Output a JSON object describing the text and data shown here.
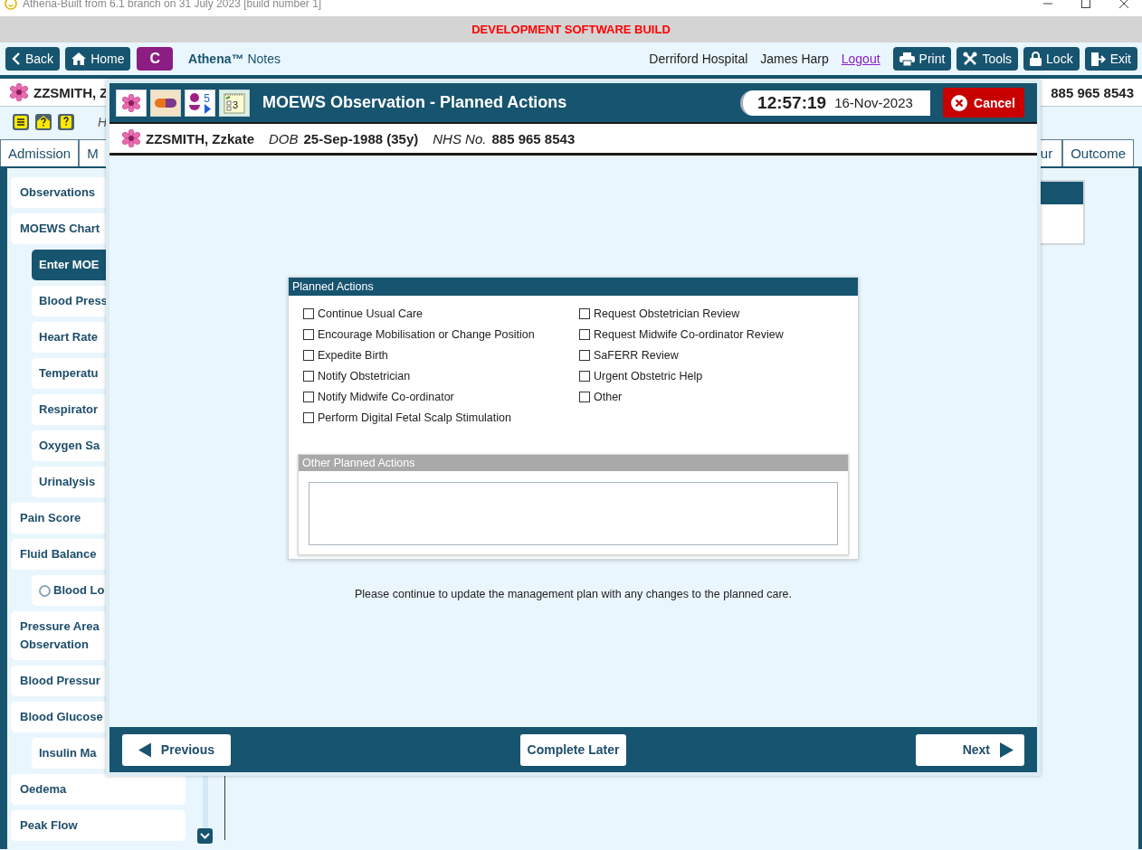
{
  "window": {
    "title": "Athena-Built from 6.1 branch on 31 July 2023 [build number 1]"
  },
  "banner": "DEVELOPMENT SOFTWARE BUILD",
  "toolbar": {
    "left_buttons": [
      {
        "kind": "back",
        "label": "Back"
      },
      {
        "kind": "home",
        "label": "Home"
      },
      {
        "kind": "letter",
        "label": "C"
      }
    ],
    "app_name": "Athena™",
    "app_section": "Notes",
    "hospital": "Derriford Hospital",
    "user": "James Harp",
    "logout": "Logout",
    "right_buttons": [
      {
        "kind": "print",
        "label": "Print"
      },
      {
        "kind": "tools",
        "label": "Tools"
      },
      {
        "kind": "lock",
        "label": "Lock"
      },
      {
        "kind": "exit",
        "label": "Exit"
      }
    ]
  },
  "patient_bar": {
    "name": "ZZSMITH, Z",
    "nhs_number": "885 965 8543"
  },
  "alert_row": {
    "icons": [
      {
        "kind": "list"
      },
      {
        "kind": "home"
      },
      {
        "kind": "note"
      }
    ],
    "heading": "H"
  },
  "tabs": [
    {
      "label": "Admission"
    },
    {
      "label": "M"
    },
    {
      "label": "ur"
    },
    {
      "label": "Outcome"
    }
  ],
  "sidebar": {
    "items": [
      {
        "label": "Observations",
        "selected": false
      },
      {
        "label": "MOEWS Chart",
        "selected": false,
        "children": [
          {
            "label": "Enter MOE",
            "selected": true
          },
          {
            "label": "Blood Press",
            "selected": false
          },
          {
            "label": "Heart Rate",
            "selected": false
          },
          {
            "label": "Temperatu",
            "selected": false
          },
          {
            "label": "Respirator",
            "selected": false
          },
          {
            "label": "Oxygen Sa",
            "selected": false
          },
          {
            "label": "Urinalysis",
            "selected": false
          }
        ]
      },
      {
        "label": "Pain Score",
        "selected": false
      },
      {
        "label": "Fluid Balance",
        "selected": false,
        "children": [
          {
            "label": "Blood Lo",
            "selected": false,
            "kind": "radio",
            "checked": false
          }
        ]
      },
      {
        "label": "Pressure Area Observation",
        "selected": false
      },
      {
        "label": "Blood Pressur",
        "selected": false
      },
      {
        "label": "Blood Glucose",
        "selected": false,
        "children": [
          {
            "label": "Insulin Ma",
            "selected": false
          }
        ]
      },
      {
        "label": "Oedema",
        "selected": false
      },
      {
        "label": "Peak Flow",
        "selected": false
      }
    ]
  },
  "dialog": {
    "icons": [
      {
        "kind": "flower"
      },
      {
        "kind": "pill"
      },
      {
        "kind": "baby",
        "badge": "5"
      },
      {
        "kind": "notepad",
        "badge": "3"
      }
    ],
    "title": "MOEWS Observation - Planned Actions",
    "time": "12:57:19",
    "date": "16-Nov-2023",
    "cancel": "Cancel",
    "patient": {
      "name": "ZZSMITH, Zzkate",
      "dob_label": "DOB",
      "dob": "25-Sep-1988 (35y)",
      "nhs_label": "NHS No.",
      "nhs": "885 965 8543"
    },
    "planned_actions": {
      "title": "Planned Actions",
      "columns": [
        [
          {
            "label": "Continue Usual Care",
            "checked": false
          },
          {
            "label": "Encourage Mobilisation or Change Position",
            "checked": false
          },
          {
            "label": "Expedite Birth",
            "checked": false
          },
          {
            "label": "Notify Obstetrician",
            "checked": false
          },
          {
            "label": "Notify Midwife Co-ordinator",
            "checked": false
          },
          {
            "label": "Perform Digital Fetal Scalp Stimulation",
            "checked": false
          }
        ],
        [
          {
            "label": "Request Obstetrician Review",
            "checked": false
          },
          {
            "label": "Request Midwife Co-ordinator Review",
            "checked": false
          },
          {
            "label": "SaFERR Review",
            "checked": false
          },
          {
            "label": "Urgent Obstetric Help",
            "checked": false
          },
          {
            "label": "Other",
            "checked": false
          }
        ]
      ],
      "other_title": "Other Planned Actions"
    },
    "note": "Please continue to update the management plan with any changes to the planned care.",
    "footer": {
      "previous": "Previous",
      "complete_later": "Complete Later",
      "next": "Next"
    }
  }
}
